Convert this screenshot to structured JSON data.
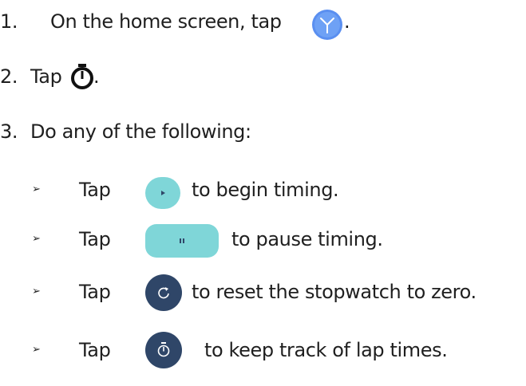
{
  "steps": [
    {
      "num": "1.",
      "text_before": "On the home screen, tap",
      "text_after": "."
    },
    {
      "num": "2.",
      "text_before": "Tap",
      "text_after": "."
    },
    {
      "num": "3.",
      "text_before": "Do any of the following:"
    }
  ],
  "bullets": [
    {
      "marker": "➢",
      "tap": "Tap",
      "text": "to begin timing.",
      "icon": "play-icon"
    },
    {
      "marker": "➢",
      "tap": "Tap",
      "text": "to pause timing.",
      "icon": "pause-icon"
    },
    {
      "marker": "➢",
      "tap": "Tap",
      "text": "to reset the stopwatch to zero.",
      "icon": "reset-icon"
    },
    {
      "marker": "➢",
      "tap": "Tap",
      "text": "to keep track of lap times.",
      "icon": "lap-icon"
    }
  ],
  "icons": {
    "clock_app": "clock-app-icon",
    "stopwatch": "stopwatch-icon"
  },
  "colors": {
    "text": "#1f1f1f",
    "teal": "#7fd6d8",
    "navy": "#2f4668",
    "clock_blue": "#5a8ff0"
  }
}
